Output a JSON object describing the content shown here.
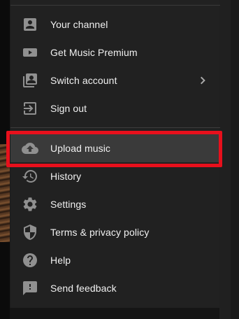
{
  "colors": {
    "menu_background": "#212121",
    "icon": "#909090",
    "text": "#f1f1f1",
    "highlight_outline": "#e8101c",
    "selected_background": "#3a3a3a"
  },
  "menu": {
    "account_section": [
      {
        "label": "Your channel",
        "icon": "account-box-icon"
      },
      {
        "label": "Get Music Premium",
        "icon": "play-badge-icon"
      },
      {
        "label": "Switch account",
        "icon": "switch-account-icon",
        "has_submenu": true
      },
      {
        "label": "Sign out",
        "icon": "exit-icon"
      }
    ],
    "main_section": [
      {
        "label": "Upload music",
        "icon": "cloud-upload-icon",
        "highlighted": true
      },
      {
        "label": "History",
        "icon": "history-icon"
      },
      {
        "label": "Settings",
        "icon": "gear-icon"
      },
      {
        "label": "Terms & privacy policy",
        "icon": "shield-icon"
      },
      {
        "label": "Help",
        "icon": "help-icon"
      },
      {
        "label": "Send feedback",
        "icon": "feedback-icon"
      }
    ]
  }
}
